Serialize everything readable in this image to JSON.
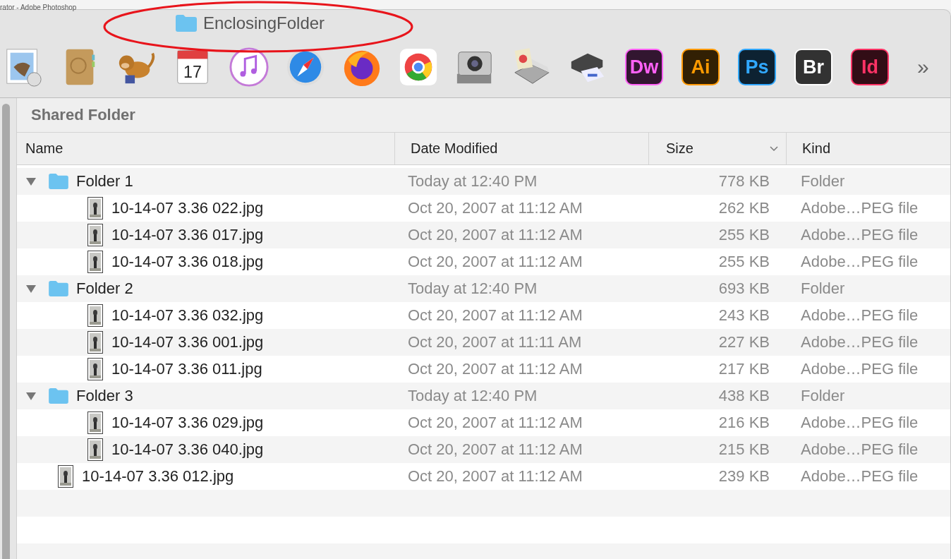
{
  "background_window": {
    "title": "rator - Adobe Photoshop"
  },
  "window": {
    "title": "EnclosingFolder"
  },
  "toolbar": {
    "calendar_day": "17",
    "app_tiles": [
      {
        "label": "Dw",
        "color": "#ff61f6"
      },
      {
        "label": "Ai",
        "color": "#ff9a00"
      },
      {
        "label": "Ps",
        "color": "#31a8ff"
      },
      {
        "label": "Br",
        "color": "#ffffff"
      },
      {
        "label": "Id",
        "color": "#ff3366"
      }
    ],
    "overflow": "»"
  },
  "panel": {
    "title": "Shared Folder"
  },
  "table": {
    "columns": [
      {
        "label": "Name",
        "sorted": false
      },
      {
        "label": "Date Modified",
        "sorted": false
      },
      {
        "label": "Size",
        "sorted": true
      },
      {
        "label": "Kind",
        "sorted": false
      }
    ],
    "rows": [
      {
        "kind": "folder",
        "name": "Folder 1",
        "date": "Today at 12:40 PM",
        "size": "778 KB",
        "file_kind": "Folder",
        "expanded": true,
        "children": [
          {
            "kind": "file",
            "name": "10-14-07 3.36 022.jpg",
            "date": "Oct 20, 2007 at 11:12 AM",
            "size": "262 KB",
            "file_kind": "Adobe…PEG file"
          },
          {
            "kind": "file",
            "name": "10-14-07 3.36 017.jpg",
            "date": "Oct 20, 2007 at 11:12 AM",
            "size": "255 KB",
            "file_kind": "Adobe…PEG file"
          },
          {
            "kind": "file",
            "name": "10-14-07 3.36 018.jpg",
            "date": "Oct 20, 2007 at 11:12 AM",
            "size": "255 KB",
            "file_kind": "Adobe…PEG file"
          }
        ]
      },
      {
        "kind": "folder",
        "name": "Folder 2",
        "date": "Today at 12:40 PM",
        "size": "693 KB",
        "file_kind": "Folder",
        "expanded": true,
        "children": [
          {
            "kind": "file",
            "name": "10-14-07 3.36 032.jpg",
            "date": "Oct 20, 2007 at 11:12 AM",
            "size": "243 KB",
            "file_kind": "Adobe…PEG file"
          },
          {
            "kind": "file",
            "name": "10-14-07 3.36 001.jpg",
            "date": "Oct 20, 2007 at 11:11 AM",
            "size": "227 KB",
            "file_kind": "Adobe…PEG file"
          },
          {
            "kind": "file",
            "name": "10-14-07 3.36 011.jpg",
            "date": "Oct 20, 2007 at 11:12 AM",
            "size": "217 KB",
            "file_kind": "Adobe…PEG file"
          }
        ]
      },
      {
        "kind": "folder",
        "name": "Folder 3",
        "date": "Today at 12:40 PM",
        "size": "438 KB",
        "file_kind": "Folder",
        "expanded": true,
        "children": [
          {
            "kind": "file",
            "name": "10-14-07 3.36 029.jpg",
            "date": "Oct 20, 2007 at 11:12 AM",
            "size": "216 KB",
            "file_kind": "Adobe…PEG file"
          },
          {
            "kind": "file",
            "name": "10-14-07 3.36 040.jpg",
            "date": "Oct 20, 2007 at 11:12 AM",
            "size": "215 KB",
            "file_kind": "Adobe…PEG file"
          }
        ]
      },
      {
        "kind": "file",
        "name": "10-14-07 3.36 012.jpg",
        "date": "Oct 20, 2007 at 11:12 AM",
        "size": "239 KB",
        "file_kind": "Adobe…PEG file"
      }
    ]
  }
}
